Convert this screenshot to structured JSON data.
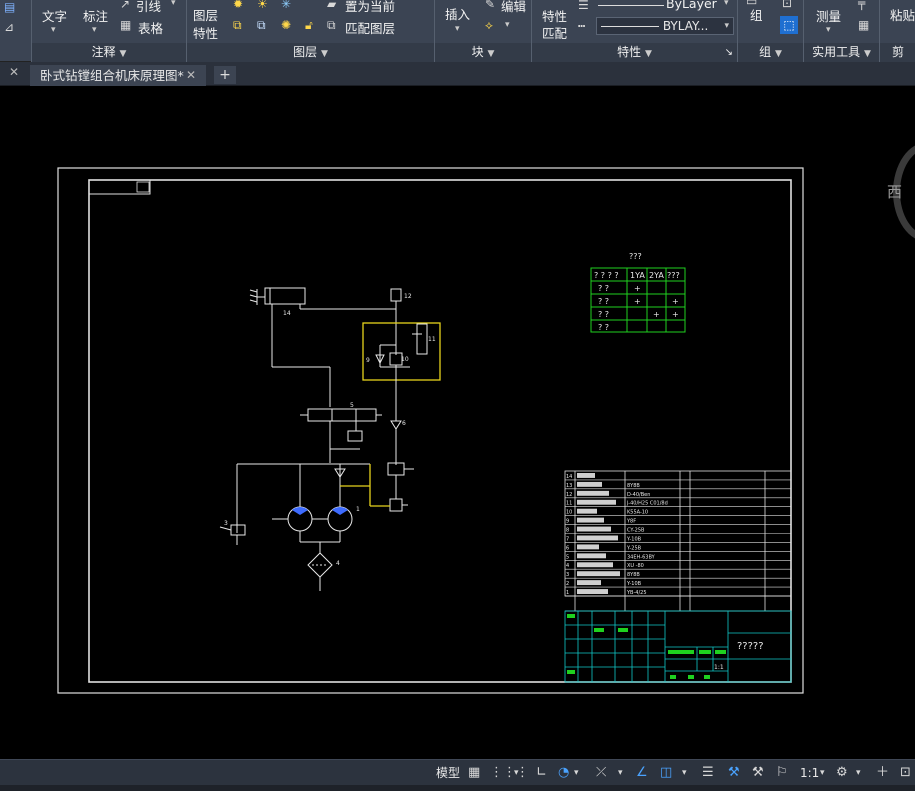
{
  "ribbon": {
    "annotation_panel": {
      "title": "注释",
      "text_label": "文字",
      "dimension_label": "标注",
      "leader_label": "引线",
      "table_label": "表格"
    },
    "layers_panel": {
      "title": "图层",
      "layer_props_label": "图层\n特性",
      "layer_props_line1": "图层",
      "layer_props_line2": "特性",
      "set_current_label": "置为当前",
      "match_layer_label": "匹配图层"
    },
    "block_panel": {
      "title": "块",
      "insert_label": "插入",
      "edit_label": "编辑"
    },
    "properties_panel": {
      "title": "特性",
      "match_line1": "特性",
      "match_line2": "匹配",
      "lineweight_value": "ByLayer",
      "linetype_value": "BYLAY..."
    },
    "group_panel": {
      "title": "组",
      "group_label": "组"
    },
    "utilities_panel": {
      "title": "实用工具",
      "measure_label": "测量"
    },
    "clipboard_panel": {
      "title": "剪贴",
      "paste_label": "粘贴"
    }
  },
  "tabs": {
    "active_title": "卧式钻镗组合机床原理图*",
    "add_label": "+"
  },
  "drawing": {
    "table_title": "???",
    "table_header": [
      "? ? ? ?",
      "1YA",
      "2YA",
      "???"
    ],
    "table_rows": [
      [
        "? ?",
        "+",
        "",
        ""
      ],
      [
        "? ?",
        "+",
        "",
        "+"
      ],
      [
        "? ?",
        "",
        "+",
        "+"
      ],
      [
        "? ?",
        "",
        "",
        ""
      ]
    ],
    "bom_numbers": [
      "14",
      "13",
      "12",
      "11",
      "10",
      "9",
      "8",
      "7",
      "6",
      "5",
      "4",
      "3",
      "2",
      "1"
    ],
    "bom_models": [
      "",
      "8Y8B",
      "D-40/Ben",
      "J-40/H25 C01/8d",
      "K55A-10",
      "Y8F",
      "CY-25B",
      "Y-10B",
      "Y-25B",
      "34EH-63BY",
      "XU -80",
      "8Y8B",
      "Y-10B",
      "YB-4/25"
    ],
    "title_block_name": "?????",
    "scale_value": "1:1",
    "part_labels": {
      "p12": "12",
      "p11": "11",
      "p10": "10",
      "p9": "9",
      "p5": "5",
      "p6": "6",
      "p4": "4",
      "p1": "1",
      "p14": "14",
      "p3": "3"
    }
  },
  "viewcube": {
    "label": "西"
  },
  "statusbar": {
    "model_label": "模型",
    "scale_label": "1:1"
  },
  "colors": {
    "ribbon_bg": "#3b4453",
    "canvas_bg": "#000000",
    "highlight_yellow": "#e6d31c",
    "table_green": "#1fd11f",
    "title_cyan": "#10c8c8",
    "active_blue": "#1f6fd1"
  }
}
